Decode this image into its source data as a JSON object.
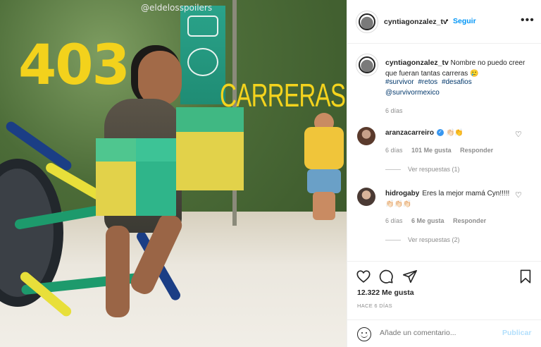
{
  "photo": {
    "watermark": "@eldelosspoilers",
    "big_number": "403",
    "big_word": "CARRERAS"
  },
  "header": {
    "username": "cyntiagonzalez_tv",
    "separator": "•",
    "follow_label": "Seguir",
    "more_label": "•••"
  },
  "caption": {
    "username": "cyntiagonzalez_tv",
    "text": "Nombre no puedo creer que fueran tantas carreras 🥲",
    "hashtags": [
      "#survivor",
      "#retos",
      "#desafios",
      "@survivormexico"
    ],
    "time": "6 días"
  },
  "comments": [
    {
      "username": "aranzacarreiro",
      "verified": true,
      "verified_mark": "✓",
      "text": "👏🏻👏",
      "time": "6 días",
      "likes": "101 Me gusta",
      "reply_label": "Responder",
      "view_replies": "Ver respuestas (1)",
      "like_icon": "♡"
    },
    {
      "username": "hidrogaby",
      "verified": false,
      "text": "Eres la mejor mamá Cyn!!!!! 👏🏻👏🏻👏🏻",
      "time": "6 días",
      "likes": "6 Me gusta",
      "reply_label": "Responder",
      "view_replies": "Ver respuestas (2)",
      "like_icon": "♡"
    }
  ],
  "actions": {
    "likes": "12.322 Me gusta",
    "post_time": "HACE 6 DÍAS",
    "icons": [
      "heart-icon",
      "comment-icon",
      "share-icon",
      "bookmark-icon"
    ]
  },
  "comment_box": {
    "placeholder": "Añade un comentario...",
    "publish_label": "Publicar"
  },
  "colors": {
    "link_blue": "#0095f6",
    "hashtag_blue": "#00376b",
    "publish_disabled": "#b2dffc",
    "title_yellow": "#f3d21c"
  }
}
